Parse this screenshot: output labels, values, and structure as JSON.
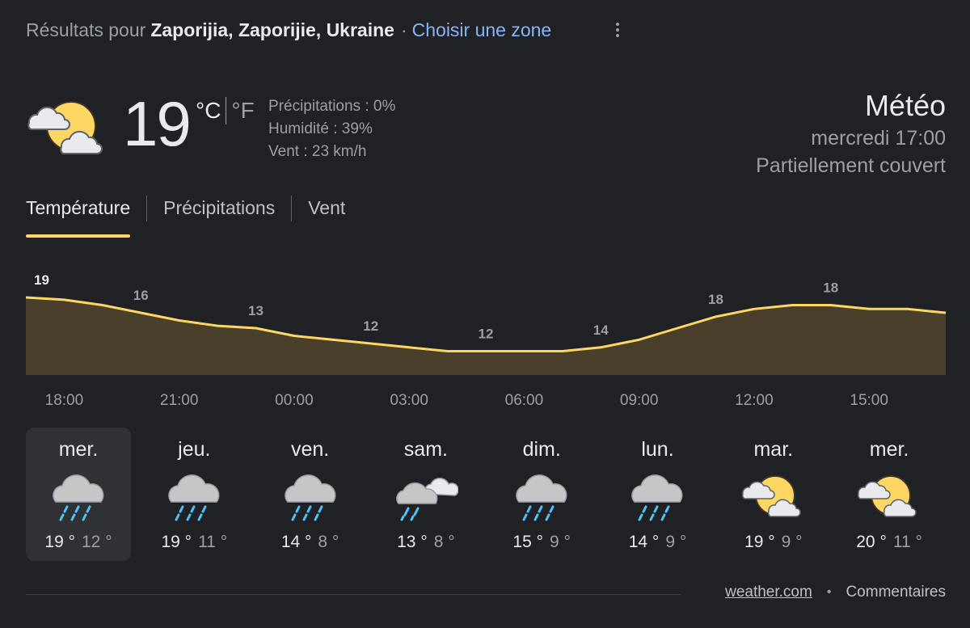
{
  "header": {
    "results_prefix": "Résultats pour",
    "location": "Zaporijia, Zaporijie, Ukraine",
    "separator": "·",
    "choose_zone": "Choisir une zone",
    "more_icon": "more-vert-icon"
  },
  "current": {
    "icon": "partly-cloudy-icon",
    "temperature": "19",
    "unit_c": "°C",
    "unit_f": "°F",
    "precipitation": "Précipitations : 0%",
    "humidity": "Humidité : 39%",
    "wind": "Vent : 23 km/h"
  },
  "summary": {
    "title": "Météo",
    "datetime": "mercredi 17:00",
    "condition": "Partiellement couvert"
  },
  "tabs": [
    {
      "label": "Température",
      "active": true
    },
    {
      "label": "Précipitations",
      "active": false
    },
    {
      "label": "Vent",
      "active": false
    }
  ],
  "chart_data": {
    "type": "area",
    "x": [
      "17:00",
      "18:00",
      "19:00",
      "20:00",
      "21:00",
      "22:00",
      "23:00",
      "00:00",
      "01:00",
      "02:00",
      "03:00",
      "04:00",
      "05:00",
      "06:00",
      "07:00",
      "08:00",
      "09:00",
      "10:00",
      "11:00",
      "12:00",
      "13:00",
      "14:00",
      "15:00",
      "16:00",
      "17:00"
    ],
    "values": [
      19,
      18.7,
      18,
      17,
      16,
      15.3,
      15,
      14,
      13.5,
      13,
      12.5,
      12,
      12,
      12,
      12,
      12.5,
      13.5,
      15,
      16.5,
      17.5,
      18,
      18,
      17.5,
      17.5,
      17
    ],
    "data_labels": [
      {
        "time": "17:00",
        "value": "19"
      },
      {
        "time": "20:00",
        "value": "16"
      },
      {
        "time": "23:00",
        "value": "13"
      },
      {
        "time": "02:00",
        "value": "12"
      },
      {
        "time": "05:00",
        "value": "12"
      },
      {
        "time": "08:00",
        "value": "14"
      },
      {
        "time": "11:00",
        "value": "18"
      },
      {
        "time": "14:00",
        "value": "18"
      }
    ],
    "tick_labels": [
      "18:00",
      "21:00",
      "00:00",
      "03:00",
      "06:00",
      "09:00",
      "12:00",
      "15:00"
    ],
    "line_color": "#fdd663",
    "fill_color": "#4a3f2a"
  },
  "days": [
    {
      "name": "mer.",
      "icon": "rain-icon",
      "high": "19 °",
      "low": "12 °",
      "selected": true
    },
    {
      "name": "jeu.",
      "icon": "rain-icon",
      "high": "19 °",
      "low": "11 °",
      "selected": false
    },
    {
      "name": "ven.",
      "icon": "rain-icon",
      "high": "14 °",
      "low": "8 °",
      "selected": false
    },
    {
      "name": "sam.",
      "icon": "rain-cloudy-icon",
      "high": "13 °",
      "low": "8 °",
      "selected": false
    },
    {
      "name": "dim.",
      "icon": "rain-icon",
      "high": "15 °",
      "low": "9 °",
      "selected": false
    },
    {
      "name": "lun.",
      "icon": "rain-icon",
      "high": "14 °",
      "low": "9 °",
      "selected": false
    },
    {
      "name": "mar.",
      "icon": "partly-cloudy-icon",
      "high": "19 °",
      "low": "9 °",
      "selected": false
    },
    {
      "name": "mer.",
      "icon": "partly-cloudy-icon",
      "high": "20 °",
      "low": "11 °",
      "selected": false
    }
  ],
  "footer": {
    "source": "weather.com",
    "bullet": "•",
    "feedback": "Commentaires"
  }
}
